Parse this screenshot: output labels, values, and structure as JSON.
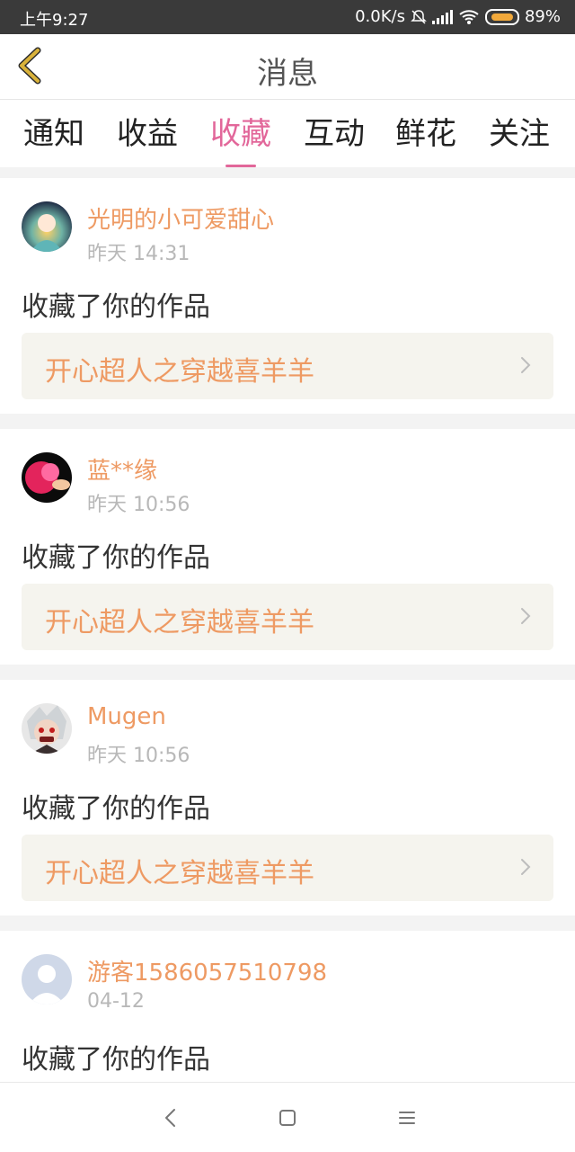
{
  "status_bar": {
    "time": "上午9:27",
    "network_speed": "0.0K/s",
    "battery_percent": "89%",
    "icons": [
      "bell-off-icon",
      "signal-icon",
      "wifi-icon",
      "battery-icon"
    ]
  },
  "header": {
    "title": "消息",
    "back_icon": "chevron-left-icon"
  },
  "tabs": [
    {
      "label": "通知"
    },
    {
      "label": "收益"
    },
    {
      "label": "收藏",
      "active": true
    },
    {
      "label": "互动"
    },
    {
      "label": "鲜花"
    },
    {
      "label": "关注"
    }
  ],
  "feed": {
    "items": [
      {
        "username": "光明的小可爱甜心",
        "time": "昨天 14:31",
        "action": "收藏了你的作品",
        "work_title": "开心超人之穿越喜羊羊"
      },
      {
        "username": "蓝**缘",
        "time": "昨天 10:56",
        "action": "收藏了你的作品",
        "work_title": "开心超人之穿越喜羊羊"
      },
      {
        "username": "Mugen",
        "time": "昨天 10:56",
        "action": "收藏了你的作品",
        "work_title": "开心超人之穿越喜羊羊"
      },
      {
        "username": "游客1586057510798",
        "time": "04-12",
        "action": "收藏了你的作品"
      }
    ]
  },
  "nav_bar": {
    "icons": [
      "back-icon",
      "home-icon",
      "menu-icon"
    ]
  },
  "colors": {
    "accent_pink": "#e2679a",
    "username_orange": "#ee9a63",
    "back_icon_gold": "#d9b23a",
    "work_bar_bg": "#f5f4ee"
  }
}
